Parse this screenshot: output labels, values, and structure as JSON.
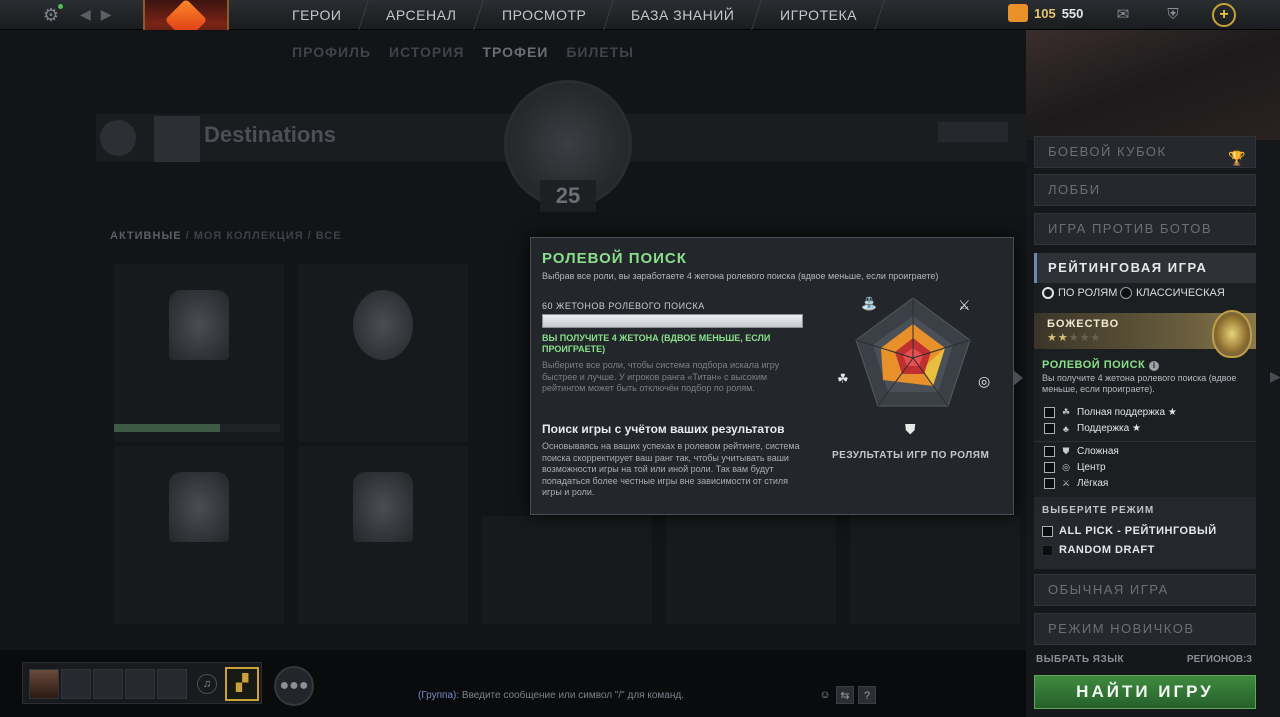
{
  "topbar": {
    "nav": [
      "ГЕРОИ",
      "АРСЕНАЛ",
      "ПРОСМОТР",
      "БАЗА ЗНАНИЙ",
      "ИГРОТЕКА"
    ],
    "currency_1": "105",
    "currency_2": "550"
  },
  "background": {
    "subtabs": [
      "ПРОФИЛЬ",
      "ИСТОРИЯ",
      "ТРОФЕИ",
      "БИЛЕТЫ"
    ],
    "profile_level": "25",
    "banner_title": "Destinations",
    "filters": [
      "АКТИВНЫЕ",
      "МОЯ КОЛЛЕКЦИЯ",
      "ВСЕ"
    ]
  },
  "right_panel": {
    "modes_top": [
      "БОЕВОЙ КУБОК",
      "ЛОББИ",
      "ИГРА ПРОТИВ БОТОВ"
    ],
    "ranked_title": "РЕЙТИНГОВАЯ ИГРА",
    "radio_roles": "ПО РОЛЯМ",
    "radio_classic": "КЛАССИЧЕСКАЯ",
    "rank_name": "БОЖЕСТВО",
    "rank_stars_on": "★★",
    "rank_stars_off": "★★★",
    "role_search_title": "РОЛЕВОЙ ПОИСК",
    "role_search_desc": "Вы получите 4 жетона ролевого поиска (вдвое меньше, если проиграете).",
    "roles_support": [
      "Полная поддержка ★",
      "Поддержка ★"
    ],
    "roles_core": [
      "Сложная",
      "Центр",
      "Лёгкая"
    ],
    "mode_choose_title": "ВЫБЕРИТЕ РЕЖИМ",
    "mode_options": [
      "ALL PICK - РЕЙТИНГОВЫЙ",
      "RANDOM DRAFT"
    ],
    "modes_bottom": [
      "ОБЫЧНАЯ ИГРА",
      "РЕЖИМ НОВИЧКОВ"
    ],
    "language": "ВЫБРАТЬ ЯЗЫК",
    "regions": "РЕГИОНОВ:3",
    "find_button": "НАЙТИ ИГРУ"
  },
  "popup": {
    "title": "РОЛЕВОЙ ПОИСК",
    "subtitle": "Выбрав все роли, вы заработаете 4 жетона ролевого поиска (вдвое меньше, если проиграете)",
    "tokens_label": "60 ЖЕТОНОВ РОЛЕВОГО ПОИСКА",
    "tokens_fill": 1.0,
    "earn_text": "ВЫ ПОЛУЧИТЕ 4 ЖЕТОНА (ВДВОЕ МЕНЬШЕ, ЕСЛИ ПРОИГРАЕТЕ)",
    "hint_text": "Выберите все роли, чтобы система подбора искала игру быстрее и лучше. У игроков ранга «Титан» с высоким рейтингом может быть отключён подбор по ролям.",
    "heading2": "Поиск игры с учётом ваших результатов",
    "body2": "Основываясь на ваших успехах в ролевом рейтинге, система поиска скорректирует ваш ранг так, чтобы учитывать ваши возможности игры на той или иной роли. Так вам будут попадаться более честные игры вне зависимости от стиля игры и роли.",
    "radar_caption": "РЕЗУЛЬТАТЫ ИГР ПО РОЛЯМ",
    "colors": {
      "accent_green": "#8adf8a",
      "radar_orange": "#e8902a",
      "radar_yellow": "#e8c040",
      "radar_red": "#c03030"
    }
  },
  "bottom": {
    "chat_group": "(Группа):",
    "chat_placeholder": "Введите сообщение или символ \"/\" для команд."
  }
}
